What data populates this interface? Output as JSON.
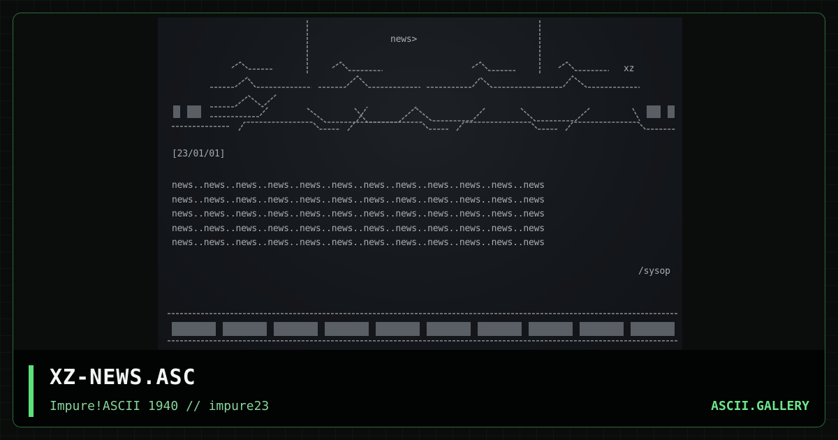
{
  "footer": {
    "title": "XZ-NEWS.ASC",
    "subtitle": "Impure!ASCII 1940 // impure23",
    "brand": "ASCII.GALLERY"
  },
  "artwork": {
    "heading": "news>",
    "tag": "xz",
    "date": "[23/01/01]",
    "news_lines": [
      "news..news..news..news..news..news..news..news..news..news..news..news",
      "news..news..news..news..news..news..news..news..news..news..news..news",
      "news..news..news..news..news..news..news..news..news..news..news..news",
      "news..news..news..news..news..news..news..news..news..news..news..news",
      "news..news..news..news..news..news..news..news..news..news..news..news"
    ],
    "signature": "/sysop"
  },
  "colors": {
    "accent": "#5ee07a",
    "border": "#2f6b3c",
    "art_text": "#a7adb4"
  }
}
